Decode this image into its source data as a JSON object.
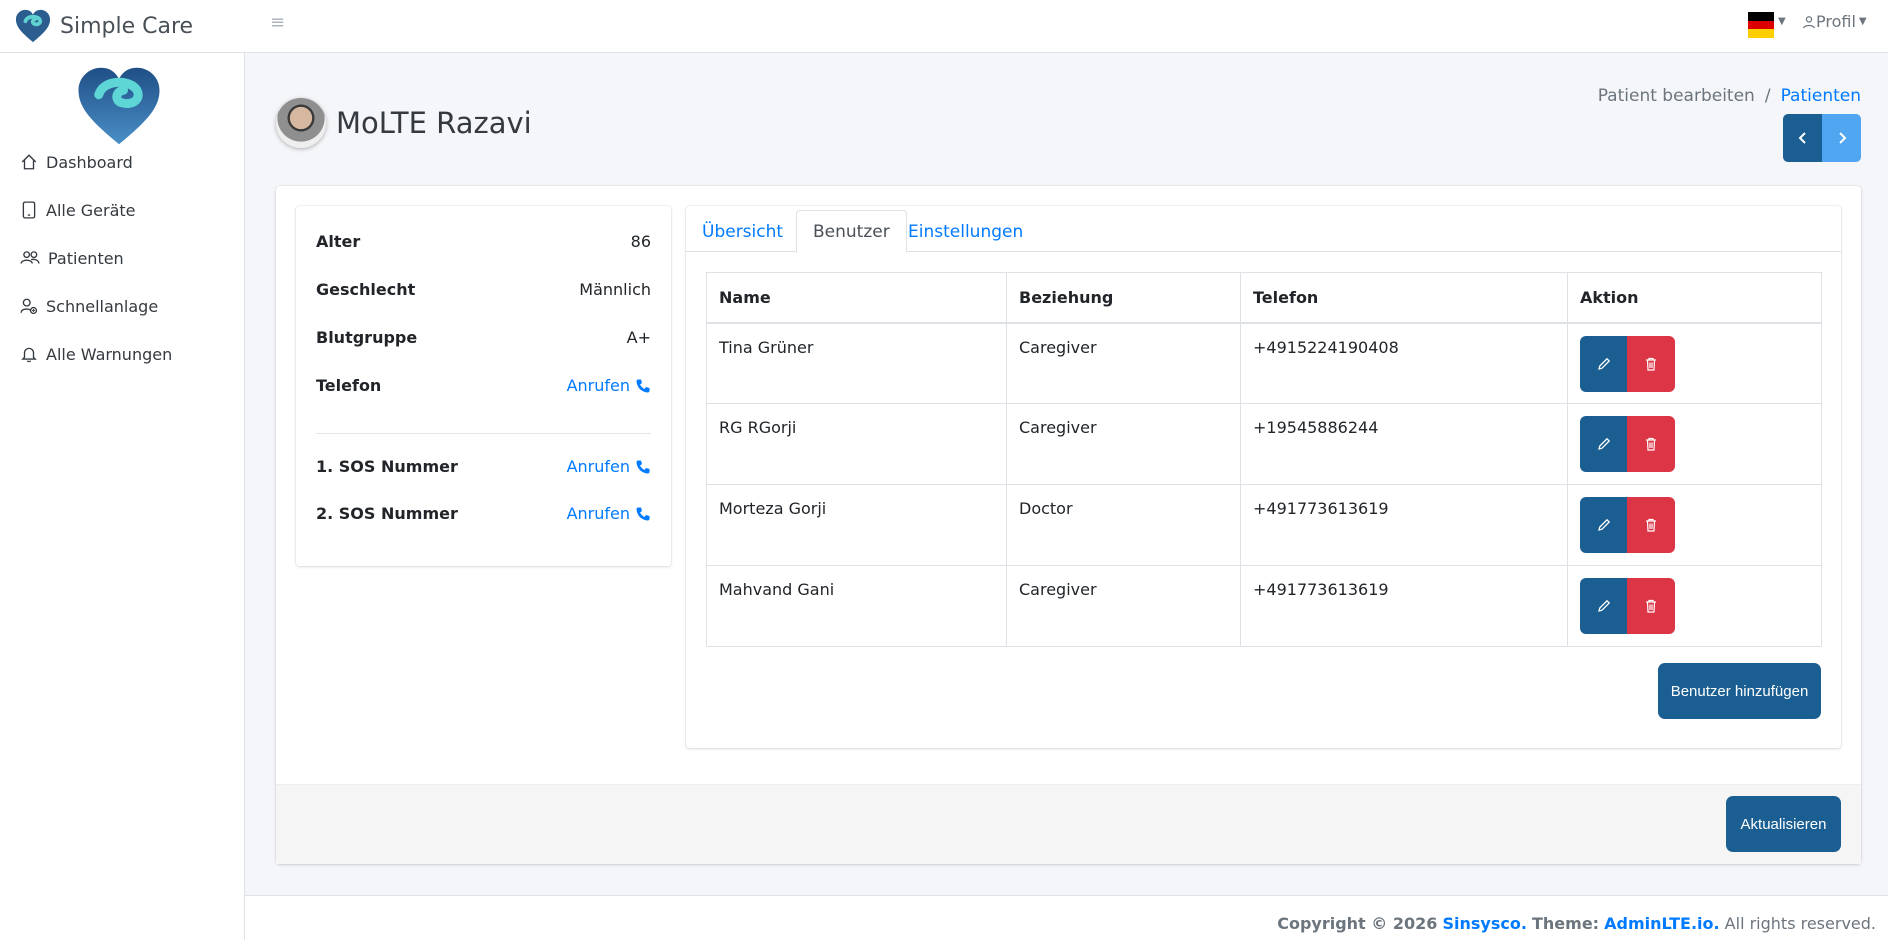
{
  "app": {
    "brand": "Simple Care"
  },
  "header": {
    "language_flag": "german-flag-icon",
    "profile_label": "Profil"
  },
  "sidebar": {
    "items": [
      {
        "label": "Dashboard",
        "icon": "home-icon"
      },
      {
        "label": "Alle Geräte",
        "icon": "tablet-icon"
      },
      {
        "label": "Patienten",
        "icon": "users-icon"
      },
      {
        "label": "Schnellanlage",
        "icon": "user-add-icon"
      },
      {
        "label": "Alle Warnungen",
        "icon": "bell-icon"
      }
    ]
  },
  "page": {
    "title": "MoLTE Razavi",
    "breadcrumb": {
      "current": "Patient bearbeiten",
      "separator": "/",
      "link": "Patienten"
    }
  },
  "patient_info": {
    "age_label": "Alter",
    "age_value": "86",
    "gender_label": "Geschlecht",
    "gender_value": "Männlich",
    "blood_label": "Blutgruppe",
    "blood_value": "A+",
    "phone_label": "Telefon",
    "phone_action": "Anrufen",
    "sos1_label": "1. SOS Nummer",
    "sos1_action": "Anrufen",
    "sos2_label": "2. SOS Nummer",
    "sos2_action": "Anrufen"
  },
  "tabs": [
    {
      "label": "Übersicht",
      "active": false
    },
    {
      "label": "Benutzer",
      "active": true
    },
    {
      "label": "Einstellungen",
      "active": false
    }
  ],
  "users_table": {
    "headers": [
      "Name",
      "Beziehung",
      "Telefon",
      "Aktion"
    ],
    "rows": [
      {
        "name": "Tina Grüner",
        "relation": "Caregiver",
        "phone": "+4915224190408"
      },
      {
        "name": "RG RGorji",
        "relation": "Caregiver",
        "phone": "+19545886244"
      },
      {
        "name": "Morteza Gorji",
        "relation": "Doctor",
        "phone": "+491773613619"
      },
      {
        "name": "Mahvand Gani",
        "relation": "Caregiver",
        "phone": "+491773613619"
      }
    ]
  },
  "buttons": {
    "add_user": "Benutzer hinzufügen",
    "update": "Aktualisieren"
  },
  "footer": {
    "copyright": "Copyright © 2026",
    "company": "Sinsysco.",
    "theme_label": "Theme:",
    "theme": "AdminLTE.io.",
    "rights": "All rights reserved."
  },
  "colors": {
    "primary": "#1a5e92",
    "danger": "#dc3545",
    "link": "#007bff"
  }
}
